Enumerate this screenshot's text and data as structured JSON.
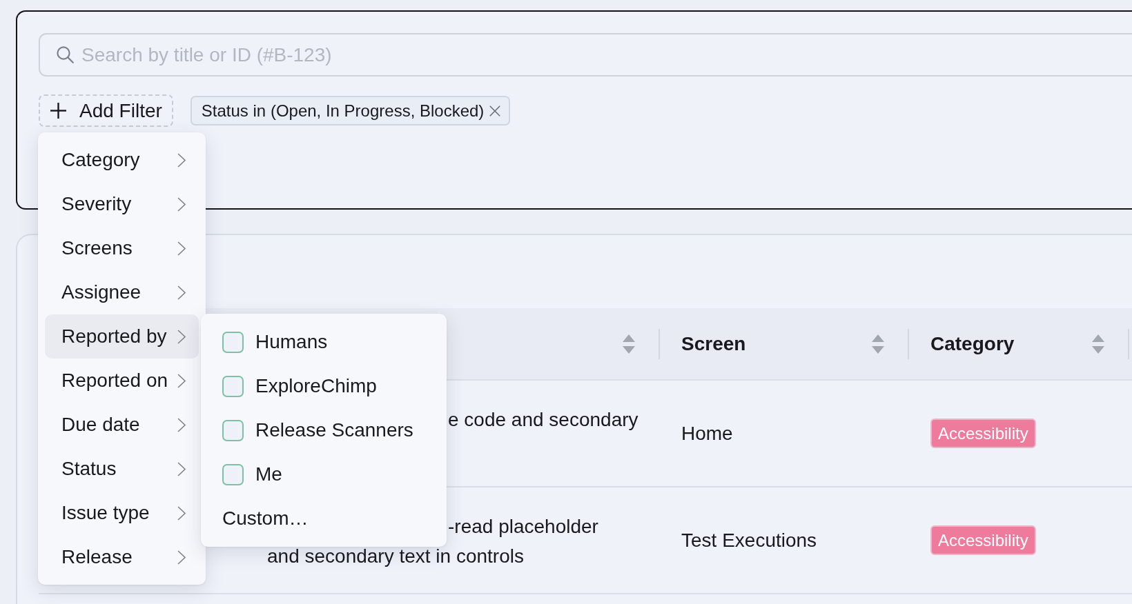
{
  "search": {
    "placeholder": "Search by title or ID (#B-123)"
  },
  "add_filter_button": {
    "label": "Add Filter"
  },
  "active_filters": [
    {
      "label": "Status in (Open, In Progress, Blocked)"
    }
  ],
  "filter_menu": {
    "items": [
      {
        "label": "Category",
        "selected": false
      },
      {
        "label": "Severity",
        "selected": false
      },
      {
        "label": "Screens",
        "selected": false
      },
      {
        "label": "Assignee",
        "selected": false
      },
      {
        "label": "Reported by",
        "selected": true,
        "submenu": {
          "options": [
            {
              "label": "Humans",
              "checked": false
            },
            {
              "label": "ExploreChimp",
              "checked": false
            },
            {
              "label": "Release Scanners",
              "checked": false
            },
            {
              "label": "Me",
              "checked": false
            }
          ],
          "custom": "Custom…"
        }
      },
      {
        "label": "Reported on",
        "selected": false
      },
      {
        "label": "Due date",
        "selected": false
      },
      {
        "label": "Status",
        "selected": false
      },
      {
        "label": "Issue type",
        "selected": false
      },
      {
        "label": "Release",
        "selected": false
      }
    ]
  },
  "table": {
    "columns": [
      {
        "sortable": true
      },
      {
        "label": "Screen",
        "sortable": true
      },
      {
        "label": "Category",
        "sortable": true
      }
    ],
    "rows": [
      {
        "column_1": [
          "e code and secondary"
        ],
        "screen": "Home",
        "category": "Accessibility"
      },
      {
        "column_1": [
          "-read placeholder",
          "and secondary text in controls"
        ],
        "screen": "Test Executions",
        "category": "Accessibility"
      }
    ]
  }
}
